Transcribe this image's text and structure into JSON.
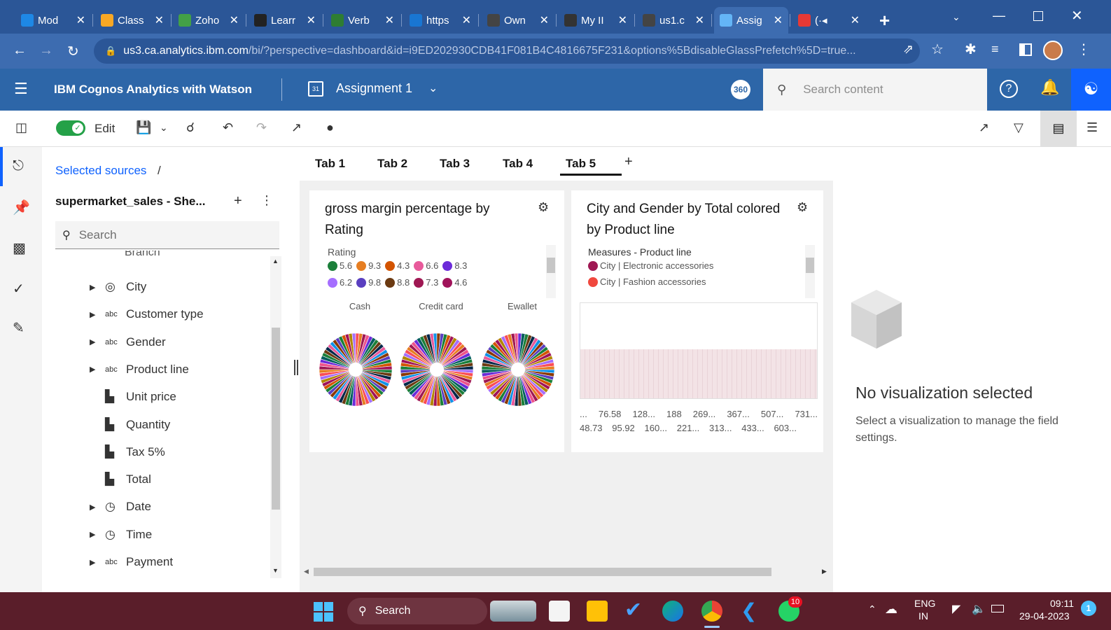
{
  "browser": {
    "tabs": [
      {
        "label": "Mod",
        "color": "#1e88e5"
      },
      {
        "label": "Class",
        "color": "#f9a825"
      },
      {
        "label": "Zoho",
        "color": "#43a047"
      },
      {
        "label": "Learr",
        "color": "#222222"
      },
      {
        "label": "Verb",
        "color": "#2e7d32"
      },
      {
        "label": "https",
        "color": "#1976d2"
      },
      {
        "label": "Own",
        "color": "#444444"
      },
      {
        "label": "My II",
        "color": "#333333"
      },
      {
        "label": "us1.c",
        "color": "#444444"
      },
      {
        "label": "Assig",
        "color": "#64b5f6"
      },
      {
        "label": "(·◂",
        "color": "#e53935"
      }
    ],
    "new_tab": "+",
    "url_domain": "us3.ca.analytics.ibm.com",
    "url_path": "/bi/?perspective=dashboard&id=i9ED202930CDB41F081B4C4816675F231&options%5BdisableGlassPrefetch%5D=true..."
  },
  "app": {
    "product_name": "IBM Cognos Analytics with Watson",
    "dashboard_name": "Assignment 1",
    "badge": "360",
    "search_placeholder": "Search content"
  },
  "toolbar": {
    "edit_label": "Edit",
    "edit_on": true
  },
  "sources": {
    "breadcrumb": "Selected sources",
    "breadcrumb_sep": "/",
    "source_name": "supermarket_sales - She...",
    "search_placeholder": "Search",
    "clipped_item": "Branch",
    "items": [
      {
        "label": "City",
        "type": "geo",
        "expandable": true
      },
      {
        "label": "Customer type",
        "type": "abc",
        "expandable": true
      },
      {
        "label": "Gender",
        "type": "abc",
        "expandable": true
      },
      {
        "label": "Product line",
        "type": "abc",
        "expandable": true
      },
      {
        "label": "Unit price",
        "type": "measure",
        "expandable": false
      },
      {
        "label": "Quantity",
        "type": "measure",
        "expandable": false
      },
      {
        "label": "Tax 5%",
        "type": "measure",
        "expandable": false
      },
      {
        "label": "Total",
        "type": "measure",
        "expandable": false
      },
      {
        "label": "Date",
        "type": "time",
        "expandable": true
      },
      {
        "label": "Time",
        "type": "time",
        "expandable": true
      },
      {
        "label": "Payment",
        "type": "abc",
        "expandable": true
      }
    ]
  },
  "dashboard": {
    "tabs": [
      "Tab 1",
      "Tab 2",
      "Tab 3",
      "Tab 4",
      "Tab 5"
    ],
    "active_tab": 4,
    "add_tab": "+",
    "card1": {
      "title_line1": "gross margin percentage by",
      "title_line2": "Rating",
      "legend_title": "Rating",
      "legend_row1": [
        {
          "label": "5.6",
          "color": "#1b7f3a"
        },
        {
          "label": "9.3",
          "color": "#e67e22"
        },
        {
          "label": "4.3",
          "color": "#d35400"
        },
        {
          "label": "6.6",
          "color": "#e85a9b"
        },
        {
          "label": "8.3",
          "color": "#6c2bd9"
        }
      ],
      "legend_row2": [
        {
          "label": "6.2",
          "color": "#a56eff"
        },
        {
          "label": "9.8",
          "color": "#5a3fc0"
        },
        {
          "label": "8.8",
          "color": "#6b3a12"
        },
        {
          "label": "7.3",
          "color": "#9f1853"
        },
        {
          "label": "4.6",
          "color": "#a0135a"
        }
      ],
      "pie_labels": [
        "Cash",
        "Credit card",
        "Ewallet"
      ]
    },
    "card2": {
      "title_line1": "City and Gender by Total colored",
      "title_line2": "by Product line",
      "legend_title": "Measures - Product line",
      "legend_items": [
        {
          "label": "City | Electronic accessories",
          "color": "#9f1853"
        },
        {
          "label": "City | Fashion accessories",
          "color": "#f0483e"
        }
      ],
      "axis_row1": [
        "...",
        "76.58",
        "128...",
        "188",
        "269...",
        "367...",
        "507...",
        "731..."
      ],
      "axis_row2": [
        "48.73",
        "95.92",
        "160...",
        "221...",
        "313...",
        "433...",
        "603..."
      ]
    }
  },
  "properties": {
    "title": "No visualization selected",
    "message": "Select a visualization to manage the field settings."
  },
  "taskbar": {
    "search_label": "Search",
    "lang_line1": "ENG",
    "lang_line2": "IN",
    "time": "09:11",
    "date": "29-04-2023",
    "whatsapp_badge": "10",
    "notif_badge": "1"
  }
}
